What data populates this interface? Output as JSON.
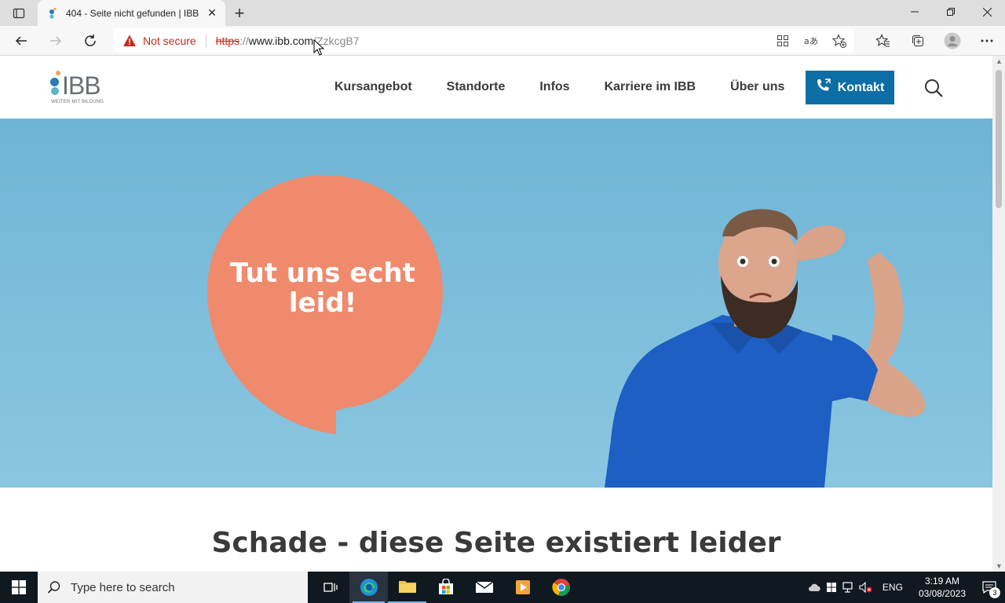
{
  "browser": {
    "tab_title": "404 - Seite nicht gefunden | IBB",
    "tab_close": "✕",
    "new_tab": "+",
    "window": {
      "minimize": "—",
      "restore": "❐",
      "close": "✕"
    },
    "address": {
      "security_label": "Not secure",
      "scheme": "https",
      "scheme_sep": "://",
      "host": "www.ibb.com",
      "path": "/ZzkcgB7"
    },
    "icons": {
      "tab_actions": "tab-actions-icon",
      "back": "back-arrow-icon",
      "forward": "forward-arrow-icon",
      "reload": "reload-icon",
      "apps": "apps-grid-icon",
      "read_aloud": "read-aloud-icon",
      "add_favorite": "add-favorite-icon",
      "favorites": "favorites-icon",
      "collections": "collections-icon",
      "profile": "profile-icon",
      "more": "more-icon"
    }
  },
  "site": {
    "logo_text": "IBB",
    "logo_tagline": "WEITER MIT BILDUNG",
    "nav": [
      {
        "label": "Kursangebot"
      },
      {
        "label": "Standorte"
      },
      {
        "label": "Infos"
      },
      {
        "label": "Karriere im IBB"
      },
      {
        "label": "Über uns"
      }
    ],
    "contact_label": "Kontakt",
    "hero": {
      "bubble_line1": "Tut uns echt",
      "bubble_line2": "leid!"
    },
    "headline": "Schade - diese Seite existiert leider"
  },
  "taskbar": {
    "search_placeholder": "Type here to search",
    "language": "ENG",
    "time": "3:19 AM",
    "date": "03/08/2023",
    "notification_count": "3"
  },
  "colors": {
    "brand_blue": "#0c6ea5",
    "hero_bg": "#7ebfdc",
    "bubble": "#ef8a6c",
    "shirt": "#1e5fc4",
    "not_secure": "#c42b1c"
  }
}
